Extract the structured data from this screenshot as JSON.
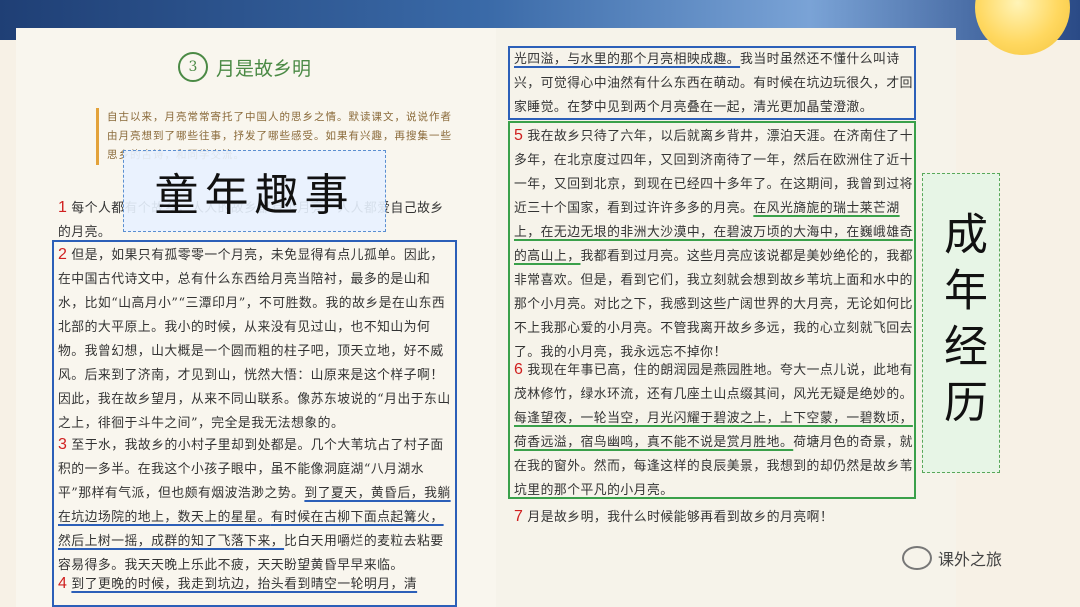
{
  "lesson": {
    "number": "3",
    "title": "月是故乡明",
    "intro": "自古以来，月亮常常寄托了中国人的思乡之情。默读课文，说说作者由月亮想到了哪些往事，抒发了哪些感受。如果有兴趣，再搜集一些思乡的古诗，和同学交流。"
  },
  "labels": {
    "childhood": "童年趣事",
    "adult": "成年经历"
  },
  "paragraphs": {
    "p1_num": "1",
    "p1": "每个人都有个故乡，人人的故乡都有个月亮。人人都爱自己故乡的月亮。",
    "p2_num": "2",
    "p2": "但是，如果只有孤零零一个月亮，未免显得有点儿孤单。因此，在中国古代诗文中，总有什么东西给月亮当陪衬，最多的是山和水，比如“山高月小”“三潭印月”，不可胜数。我的故乡是在山东西北部的大平原上。我小的时候，从来没有见过山，也不知山为何物。我曾幻想，山大概是一个圆而粗的柱子吧，顶天立地，好不威风。后来到了济南，才见到山，恍然大悟：山原来是这个样子啊！因此，我在故乡望月，从来不同山联系。像苏东坡说的“月出于东山之上，徘徊于斗牛之间”，完全是我无法想象的。",
    "p3_num": "3",
    "p3a": "至于水，我故乡的小村子里却到处都是。几个大苇坑占了村子面积的一多半。在我这个小孩子眼中，虽不能像洞庭湖“八月湖水平”那样有气派，但也颇有烟波浩渺之势。",
    "p3b": "到了夏天，黄昏后，我躺在坑边场院的地上，数天上的星星。",
    "p3c": "有时候在古柳下面点起篝火，然后上树一摇，成群的知了飞落下来，",
    "p3d": "比白天用嚼烂的麦粒去粘要容易得多。我天天晚上乐此不疲，天天盼望黄昏早早来临。",
    "p4_num": "4",
    "p4a": "到了更晚的时候，我走到坑边，抬头看到晴空一轮明月，清",
    "p4b": "光四溢，与水里的那个月亮相映成趣。",
    "p4c": "我当时虽然还不懂什么叫诗兴，可觉得心中油然有什么东西在萌动。有时候在坑边玩很久，才回家睡觉。在梦中见到两个月亮叠在一起，清光更加晶莹澄澈。",
    "p5_num": "5",
    "p5a": "我在故乡只待了六年，以后就离乡背井，漂泊天涯。在济南住了十多年，在北京度过四年，又回到济南待了一年，然后在欧洲住了近十一年，又回到北京，到现在已经四十多年了。在这期间，我曾到过将近三十个国家，看到过许许多多的月亮。",
    "p5b": "在风光旖旎的瑞士莱芒湖上，在无边无垠的非洲大沙漠中，在碧波万顷的大海中，在巍峨雄奇的高山上，",
    "p5c": "我都看到过月亮。这些月亮应该说都是美妙绝伦的，我都非常喜欢。但是，看到它们，我立刻就会想到故乡苇坑上面和水中的那个小月亮。对比之下，我感到这些广阔世界的大月亮，无论如何比不上我那心爱的小月亮。不管我离开故乡多远，我的心立刻就飞回去了。我的小月亮，我永远忘不掉你！",
    "p6_num": "6",
    "p6a": "我现在年事已高，住的朗润园是燕园胜地。夸大一点儿说，此地有茂林修竹，绿水环流，还有几座土山点缀其间，风光无疑是绝妙的。",
    "p6b": "每逢望夜，一轮当空，月光闪耀于碧波之上，上下空蒙，一碧数顷，荷香远溢，宿鸟幽鸣，真不能不说是赏月胜地。",
    "p6c": "荷塘月色的奇景，就在我的窗外。然而，每逢这样的良辰美景，我想到的却仍然是故乡苇坑里的那个平凡的小月亮。",
    "p7_num": "7",
    "p7": "月是故乡明，我什么时候能够再看到故乡的月亮啊！"
  },
  "watermark": {
    "text": "课外之旅"
  }
}
